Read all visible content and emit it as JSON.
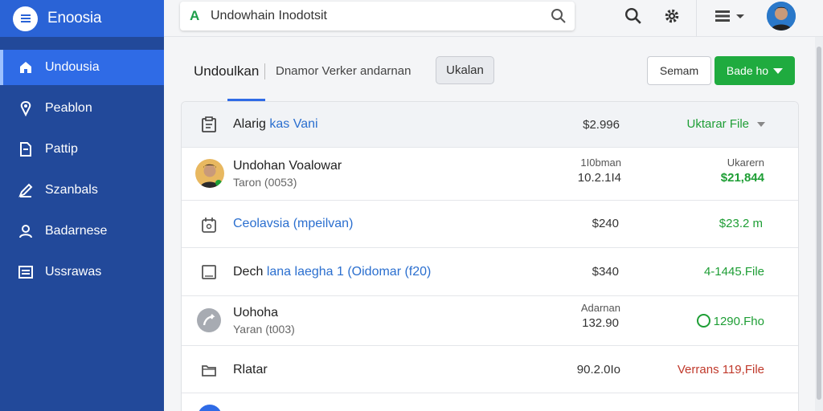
{
  "brand": {
    "name": "Enoosia"
  },
  "sidebar": {
    "items": [
      {
        "label": "Undousia",
        "icon": "home-icon",
        "active": true
      },
      {
        "label": "Peablon",
        "icon": "tag-icon",
        "active": false
      },
      {
        "label": "Pattip",
        "icon": "document-icon",
        "active": false
      },
      {
        "label": "Szanbals",
        "icon": "edit-icon",
        "active": false
      },
      {
        "label": "Badarnese",
        "icon": "user-group-icon",
        "active": false
      },
      {
        "label": "Ussrawas",
        "icon": "list-icon",
        "active": false
      }
    ]
  },
  "topbar": {
    "search_value": "Undowhain Inodotsit",
    "search_logo": "A",
    "icons": [
      "search-icon",
      "gear-icon",
      "menu-icon",
      "avatar"
    ]
  },
  "header": {
    "title": "Undoulkan",
    "subtitle": "Dnamor Verker andarnan",
    "tab_button": "Ukalan",
    "secondary_button": "Semam",
    "primary_button": "Bade ho"
  },
  "table": {
    "header": {
      "name": "Alarig",
      "name_highlight": "kas Vani",
      "amount": "$2.996",
      "action": "Uktarar File"
    },
    "rows": [
      {
        "icon": "person-avatar",
        "name": "Undohan Voalowar",
        "sub": "Taron (0053)",
        "mid_top": "1I0bman",
        "mid": "10.2.1I4",
        "right_top": "Ukarern",
        "right": "$21,844",
        "right_color": "green"
      },
      {
        "icon": "calendar-icon",
        "name": "Ceolavsia (mpeilvan)",
        "name_color": "blue",
        "mid": "$240",
        "right": "$23.2 m",
        "right_color": "green"
      },
      {
        "icon": "square-icon",
        "name": "Dech",
        "name_highlight": "lana laegha 1 (Oidomar (f20)",
        "mid": "$340",
        "right": "4-1445.File",
        "right_color": "green"
      },
      {
        "icon": "share-circle-icon",
        "name": "Uohoha",
        "sub": "Yaran (t003)",
        "mid_top": "Adarnan",
        "mid": "132.90",
        "right": "1290.Fho",
        "right_color": "green",
        "right_icon": "check-circle-icon"
      },
      {
        "icon": "folder-icon",
        "name": "Rlatar",
        "mid": "90.2.0Io",
        "right": "Verrans 119,File",
        "right_color": "red"
      }
    ]
  },
  "colors": {
    "sidebar": "#22499a",
    "sidebar_active": "#2f6be6",
    "accent_green": "#1fab3f",
    "link_blue": "#2b6fcf",
    "danger_red": "#c0392b"
  }
}
